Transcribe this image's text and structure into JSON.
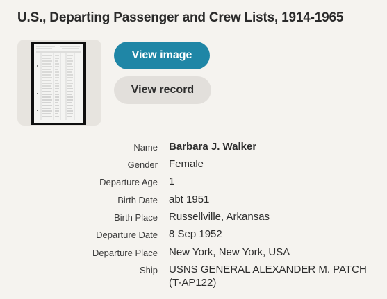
{
  "collection": {
    "title": "U.S., Departing Passenger and Crew Lists, 1914-1965"
  },
  "actions": {
    "view_image_label": "View image",
    "view_record_label": "View record"
  },
  "record": {
    "rows": [
      {
        "label": "Name",
        "value": "Barbara J. Walker"
      },
      {
        "label": "Gender",
        "value": "Female"
      },
      {
        "label": "Departure Age",
        "value": "1"
      },
      {
        "label": "Birth Date",
        "value": "abt 1951"
      },
      {
        "label": "Birth Place",
        "value": "Russellville, Arkansas"
      },
      {
        "label": "Departure Date",
        "value": "8 Sep 1952"
      },
      {
        "label": "Departure Place",
        "value": "New York, New York, USA"
      },
      {
        "label": "Ship",
        "value": "USNS GENERAL ALEXANDER M. PATCH (T-AP122)"
      }
    ]
  },
  "colors": {
    "background": "#f5f3ef",
    "primary_button": "#1f86a6",
    "secondary_button": "#e2dfdb"
  }
}
